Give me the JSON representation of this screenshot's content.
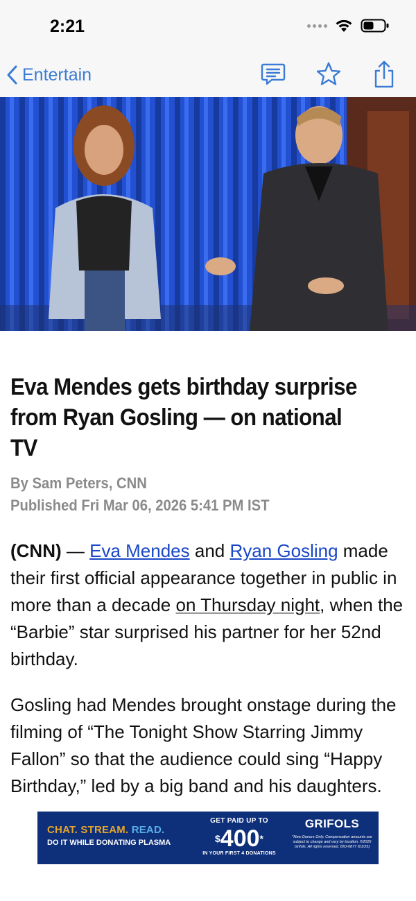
{
  "status_bar": {
    "time": "2:21"
  },
  "nav": {
    "back_label": "Entertain",
    "icons": [
      "back-chevron-icon",
      "comment-icon",
      "star-icon",
      "share-icon"
    ],
    "accent_color": "#3a7bd5"
  },
  "hero_image": {
    "alt": "Eva Mendes and Ryan Gosling onstage"
  },
  "article": {
    "headline": "Eva Mendes gets birthday surprise from Ryan Gosling — on national TV",
    "byline": "By Sam Peters, CNN",
    "published": "Published Fri Mar 06, 2026 5:41 PM IST",
    "p1": {
      "tag": "(CNN)",
      "dash": " — ",
      "link1": "Eva Mendes",
      "and": " and ",
      "link2": "Ryan Gosling",
      "text1": " made their first official appearance together in public in more than a decade ",
      "underlined": "on Thursday night",
      "text2": ", when the “Barbie” star surprised his partner for her 52nd birthday."
    },
    "p2": "Gosling had Mendes brought onstage during the filming of “The Tonight Show Starring Jimmy Fallon” so that the audience could sing “Happy Birthday,” led by a big band and his daughters."
  },
  "ad": {
    "headline_part1": "CHAT. STREAM. ",
    "headline_part2": "READ.",
    "subline": "DO IT WHILE DONATING PLASMA",
    "top_line": "GET PAID UP TO",
    "currency": "$",
    "amount": "400",
    "asterisk": "*",
    "bottom_line": "IN YOUR FIRST 4 DONATIONS",
    "brand": "GRIFOLS",
    "fine_print": "*New Donors Only. Compensation amounts are subject to change and vary by location. ©2025 Grifols. All rights reserved. BIO-0877 (01/25)",
    "colors": {
      "background": "#0e2f7a",
      "gold": "#e5a52a",
      "blue": "#5aaee8"
    }
  }
}
